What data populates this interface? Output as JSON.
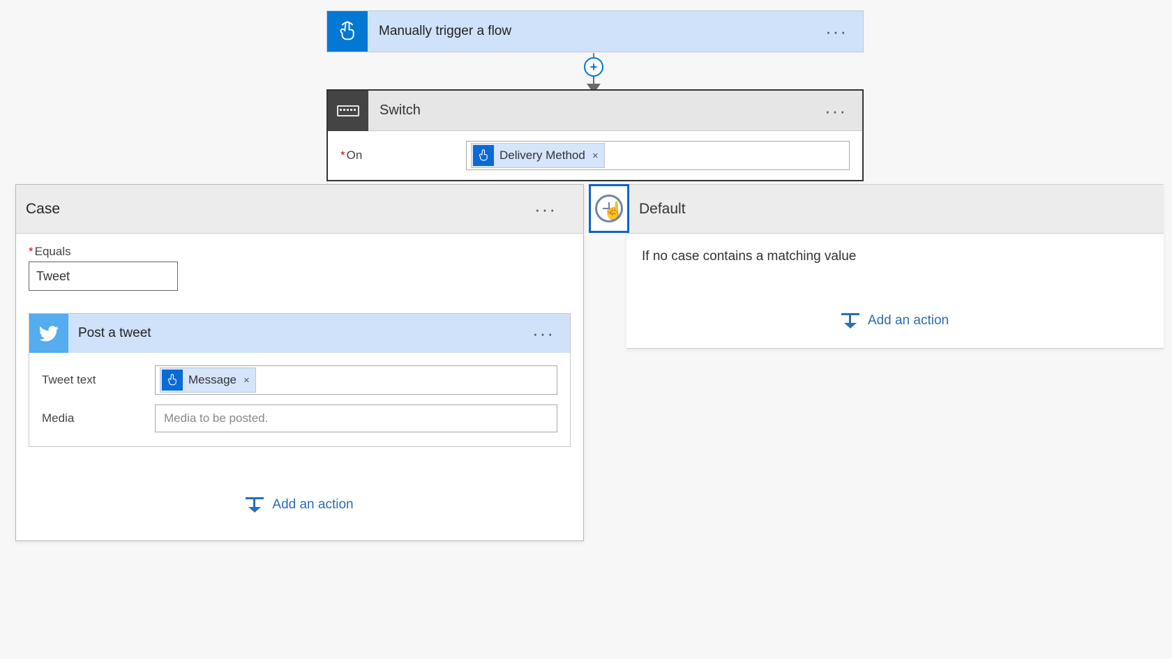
{
  "trigger": {
    "title": "Manually trigger a flow"
  },
  "switch": {
    "title": "Switch",
    "on_label": "On",
    "token_label": "Delivery Method"
  },
  "case": {
    "title": "Case",
    "equals_label": "Equals",
    "equals_value": "Tweet",
    "action": {
      "title": "Post a tweet",
      "tweet_text_label": "Tweet text",
      "tweet_text_token": "Message",
      "media_label": "Media",
      "media_placeholder": "Media to be posted."
    },
    "add_action_label": "Add an action"
  },
  "default": {
    "title": "Default",
    "description": "If no case contains a matching value",
    "add_action_label": "Add an action"
  }
}
